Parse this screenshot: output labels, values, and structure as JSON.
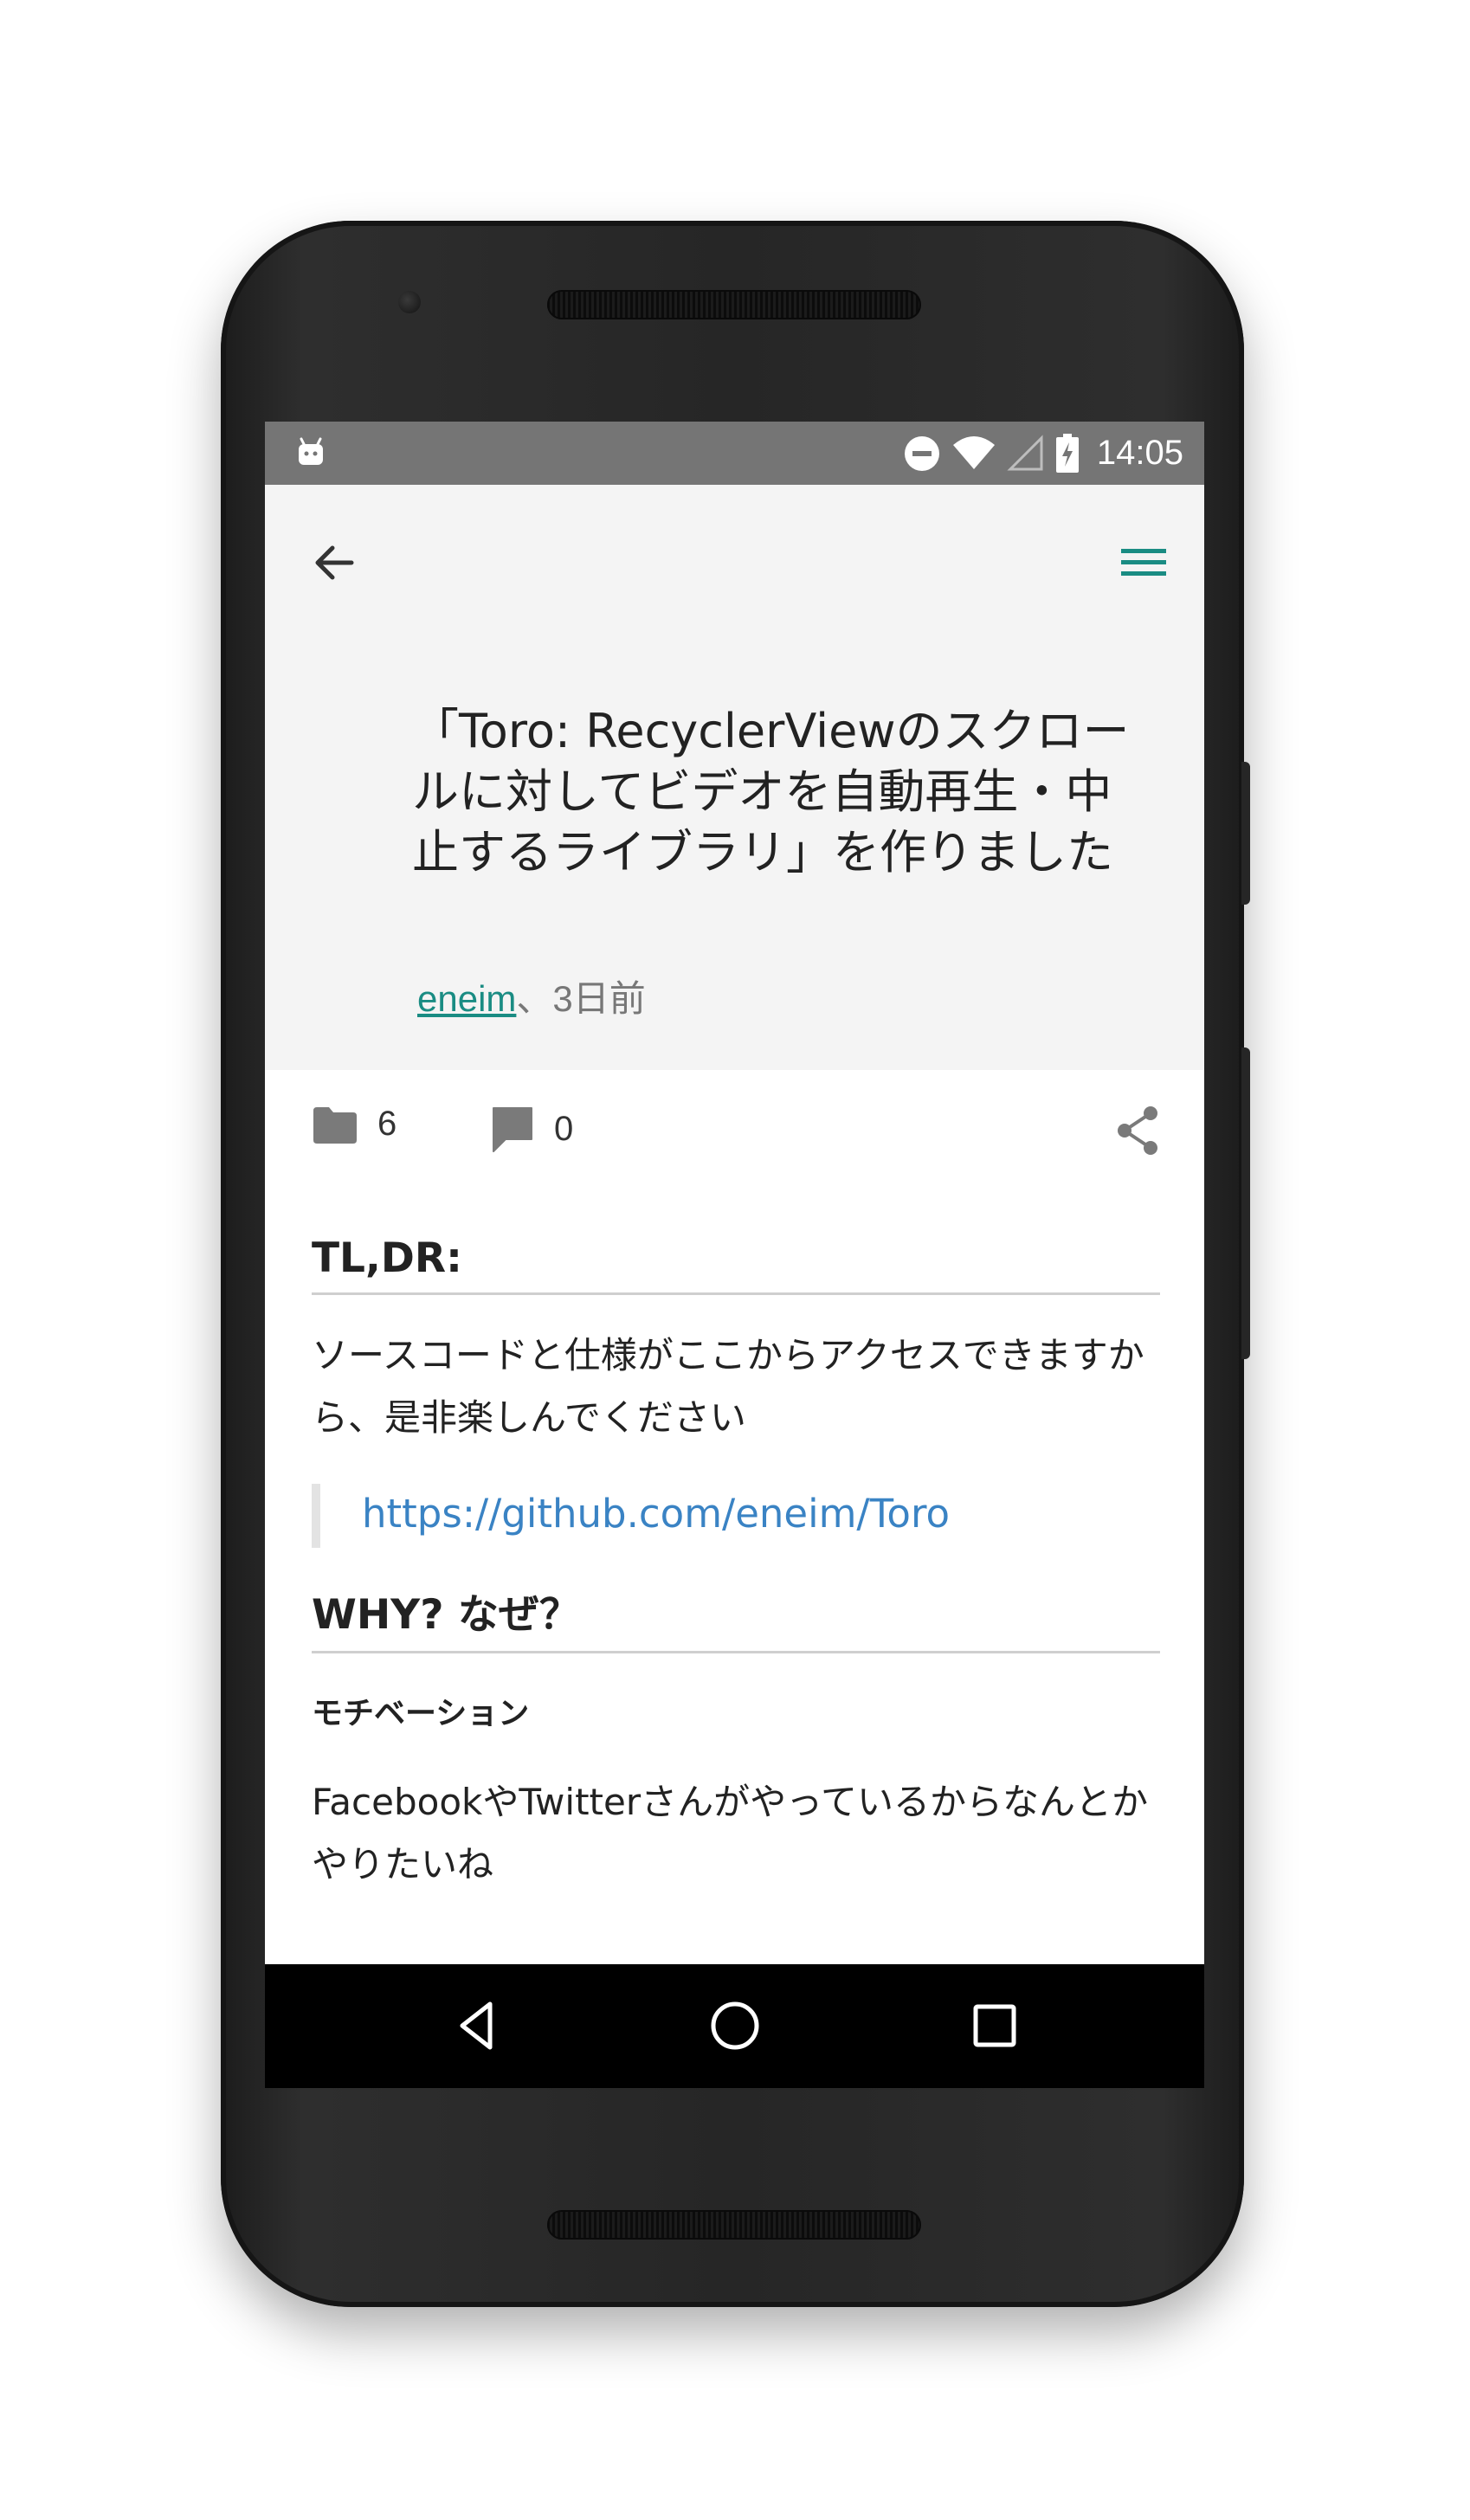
{
  "status": {
    "time": "14:05",
    "left_icon": "android-debug-icon",
    "right_icons": [
      "do-not-disturb-icon",
      "wifi-icon",
      "cell-signal-icon",
      "battery-charging-icon"
    ]
  },
  "toolbar": {
    "back_icon": "arrow-back-icon",
    "menu_icon": "hamburger-menu-icon",
    "menu_color": "#1a8c83"
  },
  "article": {
    "title": "「Toro: RecyclerViewのスクロールに対してビデオを自動再生・中止するライブラリ」を作りました",
    "author": "eneim",
    "separator": "、",
    "time_ago": "3日前"
  },
  "actions": {
    "folder_count": "6",
    "comment_count": "0",
    "share_icon": "share-icon"
  },
  "content": {
    "heading1": "TL,DR:",
    "paragraph1": "ソースコードと仕様がここからアクセスできますから、是非楽しんでください",
    "link": "https://github.com/eneim/Toro",
    "heading2": "WHY? なぜ？",
    "subheading": "モチベーション",
    "paragraph2": "FacebookやTwitterさんがやっているからなんとかやりたいね"
  },
  "navbar": {
    "icons": [
      "nav-back-icon",
      "nav-home-icon",
      "nav-recents-icon"
    ]
  }
}
